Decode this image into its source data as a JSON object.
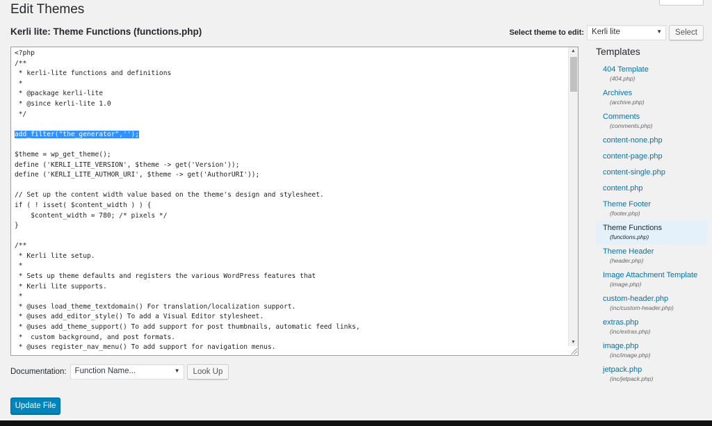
{
  "page": {
    "title": "Edit Themes",
    "file_title": "Kerli lite: Theme Functions (functions.php)"
  },
  "theme_select": {
    "label": "Select theme to edit:",
    "value": "Kerli lite",
    "button": "Select"
  },
  "editor": {
    "lines": [
      "<?php",
      "/**",
      " * kerli-lite functions and definitions",
      " *",
      " * @package kerli-lite",
      " * @since kerli-lite 1.0",
      " */",
      "",
      "add_filter(\"the_generator\",'');",
      "",
      "$theme = wp_get_theme();",
      "define ('KERLI_LITE_VERSION', $theme -> get('Version'));",
      "define ('KERLI_LITE_AUTHOR_URI', $theme -> get('AuthorURI'));",
      "",
      "// Set up the content width value based on the theme's design and stylesheet.",
      "if ( ! isset( $content_width ) ) {",
      "    $content_width = 780; /* pixels */",
      "}",
      "",
      "/**",
      " * Kerli lite setup.",
      " *",
      " * Sets up theme defaults and registers the various WordPress features that",
      " * Kerli lite supports.",
      " *",
      " * @uses load_theme_textdomain() For translation/localization support.",
      " * @uses add_editor_style() To add a Visual Editor stylesheet.",
      " * @uses add_theme_support() To add support for post thumbnails, automatic feed links,",
      " *  custom background, and post formats.",
      " * @uses register_nav_menu() To add support for navigation menus."
    ],
    "highlighted_line_index": 8
  },
  "documentation": {
    "label": "Documentation:",
    "select_value": "Function Name...",
    "button": "Look Up"
  },
  "update_button": "Update File",
  "templates": {
    "heading": "Templates",
    "items": [
      {
        "name": "404 Template",
        "file": "(404.php)"
      },
      {
        "name": "Archives",
        "file": "(archive.php)"
      },
      {
        "name": "Comments",
        "file": "(comments.php)"
      },
      {
        "name": "content-none.php",
        "file": ""
      },
      {
        "name": "content-page.php",
        "file": ""
      },
      {
        "name": "content-single.php",
        "file": ""
      },
      {
        "name": "content.php",
        "file": ""
      },
      {
        "name": "Theme Footer",
        "file": "(footer.php)"
      },
      {
        "name": "Theme Functions",
        "file": "(functions.php)",
        "active": true
      },
      {
        "name": "Theme Header",
        "file": "(header.php)"
      },
      {
        "name": "Image Attachment Template",
        "file": "(image.php)"
      },
      {
        "name": "custom-header.php",
        "file": "(inc/custom-header.php)"
      },
      {
        "name": "extras.php",
        "file": "(inc/extras.php)"
      },
      {
        "name": "image.php",
        "file": "(inc/image.php)"
      },
      {
        "name": "jetpack.php",
        "file": "(inc/jetpack.php)"
      }
    ]
  },
  "colors": {
    "link": "#0073aa",
    "primary_button": "#0085ba",
    "selection": "#3390ff",
    "active_template_bg": "#e4f1fa"
  }
}
